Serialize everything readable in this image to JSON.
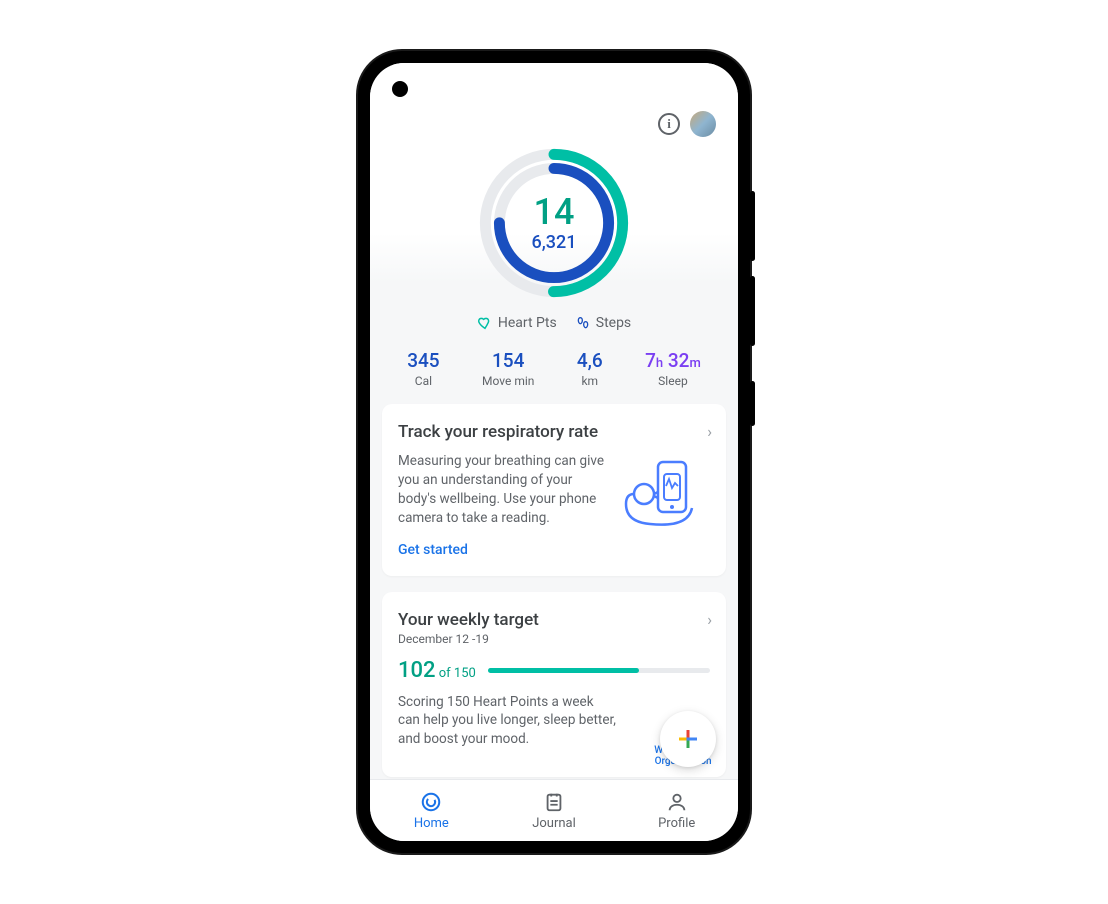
{
  "ring": {
    "primary": "14",
    "secondary": "6,321"
  },
  "legend": {
    "heart": "Heart Pts",
    "steps": "Steps"
  },
  "stats": {
    "cal": {
      "value": "345",
      "label": "Cal"
    },
    "move": {
      "value": "154",
      "label": "Move min"
    },
    "km": {
      "value": "4,6",
      "label": "km"
    },
    "sleep": {
      "h": "7",
      "hUnit": "h",
      "m": "32",
      "mUnit": "m",
      "label": "Sleep"
    }
  },
  "card1": {
    "title": "Track your respiratory rate",
    "body": "Measuring your breathing can give you an understanding of your body's wellbeing. Use your phone camera to take a reading.",
    "link": "Get started"
  },
  "card2": {
    "title": "Your weekly target",
    "subtitle": "December 12 -19",
    "value": "102",
    "of": " of 150",
    "body": "Scoring 150 Heart Points a week can help you live longer, sleep better, and boost your mood.",
    "who1": "World Health",
    "who2": "Organization"
  },
  "nav": {
    "home": "Home",
    "journal": "Journal",
    "profile": "Profile"
  },
  "colors": {
    "teal": "#00bfa5",
    "blue": "#1a4fbf",
    "link": "#1a73e8"
  }
}
